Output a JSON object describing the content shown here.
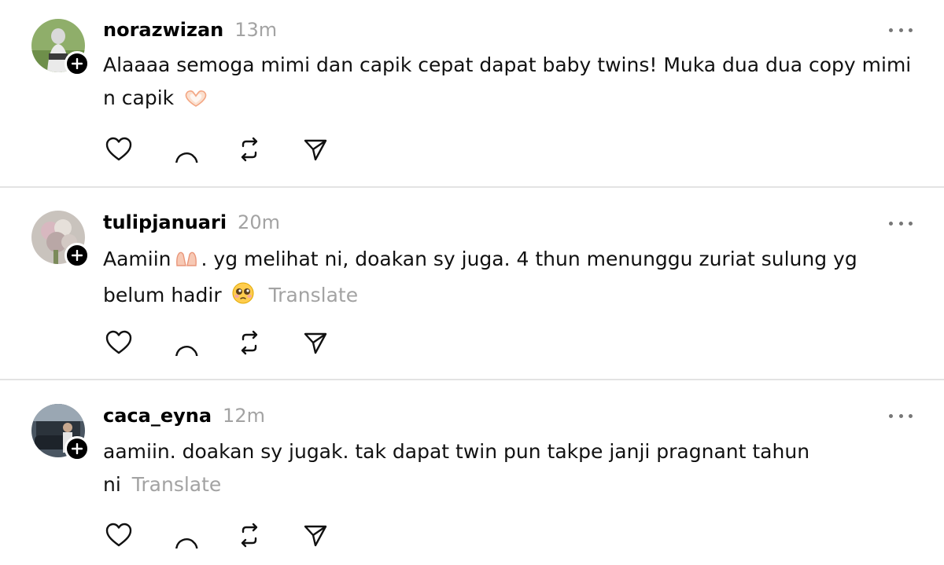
{
  "comments": [
    {
      "username": "norazwizan",
      "time": "13m",
      "text_line1": "Alaaaa semoga mimi dan capik cepat dapat baby twins! Muka dua dua copy mimi",
      "text_line2": "n capik",
      "emoji": "heart-hands-emoji",
      "translate": ""
    },
    {
      "username": "tulipjanuari",
      "time": "20m",
      "text_a": "Aamiin",
      "emoji_a": "palms-up-emoji",
      "text_b": ". yg melihat ni, doakan sy juga. 4 thun menunggu zuriat sulung yg",
      "text_line2": "belum hadir",
      "emoji_b": "pleading-face-emoji",
      "translate": "Translate"
    },
    {
      "username": "caca_eyna",
      "time": "12m",
      "text_line1": "aamiin. doakan sy jugak. tak dapat twin pun takpe janji pragnant tahun",
      "text_line2": "ni",
      "translate": "Translate"
    }
  ],
  "icons": {
    "like": "heart-icon",
    "reply": "comment-bubble-icon",
    "repost": "repost-icon",
    "share": "send-icon",
    "more": "more-dots-icon",
    "follow": "plus-icon"
  },
  "colors": {
    "muted": "#a3a3a3",
    "divider": "#e3e3e3",
    "text": "#111111"
  }
}
